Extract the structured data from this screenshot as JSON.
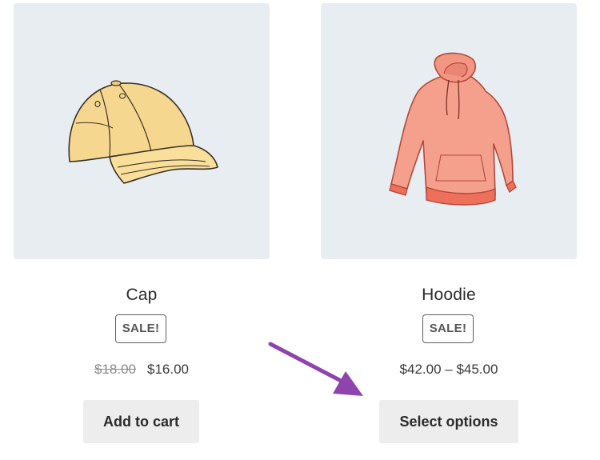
{
  "products": [
    {
      "name": "Cap",
      "badge": "SALE!",
      "regular_price": "$18.00",
      "sale_price": "$16.00",
      "button_label": "Add to cart",
      "image": "cap-illustration"
    },
    {
      "name": "Hoodie",
      "badge": "SALE!",
      "price_range": "$42.00 – $45.00",
      "button_label": "Select options",
      "image": "hoodie-illustration"
    }
  ],
  "colors": {
    "thumbnail_bg": "#e8edf2",
    "button_bg": "#ededed",
    "arrow": "#8e44ad",
    "cap": "#f7d88e",
    "hoodie": "#f29a86"
  },
  "annotation": {
    "arrow_icon": "arrow-pointing-to-select-options"
  }
}
